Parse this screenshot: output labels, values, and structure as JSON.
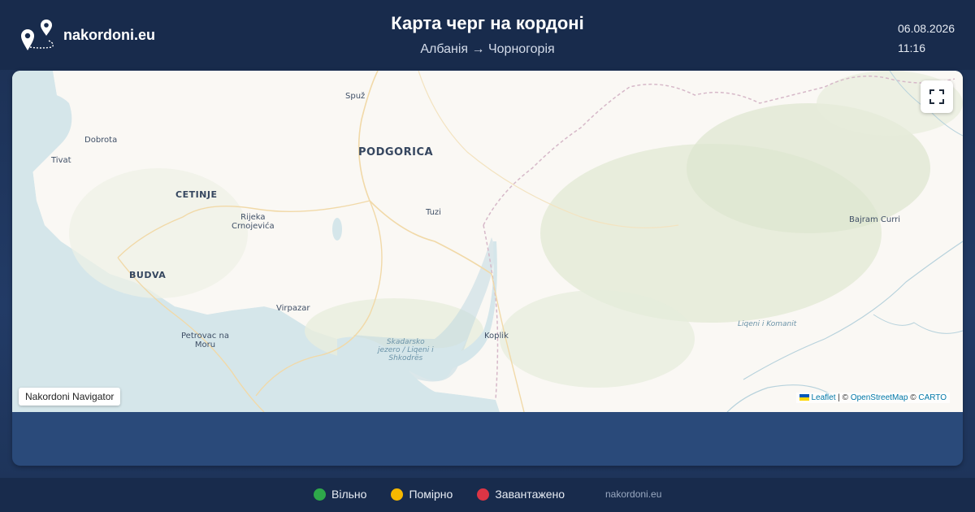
{
  "header": {
    "site_name": "nakordoni.eu",
    "title": "Карта черг на кордоні",
    "route": "Албанія → Чорногорія",
    "date": "06.08.2026",
    "time": "11:16"
  },
  "map": {
    "places": {
      "spuz": "Spuž",
      "podgorica": "PODGORICA",
      "dobrota": "Dobrota",
      "tivat": "Tivat",
      "cetinje": "CETINJE",
      "rijeka": "Rijeka\nCrnojevića",
      "tuzi": "Tuzi",
      "budva": "BUDVA",
      "virpazar": "Virpazar",
      "petrovac": "Petrovac na\nMoru",
      "skadarsko": "Skadarsko\njezero / Liqeni i\nShkodrës",
      "koplik": "Koplik",
      "bajram_curri": "Bajram Curri",
      "liqeni_komanit": "Liqeni i Komanit"
    },
    "fullscreen_icon": "fullscreen-icon",
    "navigator_label": "Nakordoni Navigator",
    "attribution": {
      "leaflet": "Leaflet",
      "sep1": " | © ",
      "osm": "OpenStreetMap",
      "sep2": " © ",
      "carto": "CARTO"
    }
  },
  "legend": {
    "items": [
      {
        "label": "Вільно",
        "color": "#2ea84a"
      },
      {
        "label": "Помірно",
        "color": "#f5b800"
      },
      {
        "label": "Завантажено",
        "color": "#dc3545"
      }
    ],
    "site": "nakordoni.eu"
  }
}
